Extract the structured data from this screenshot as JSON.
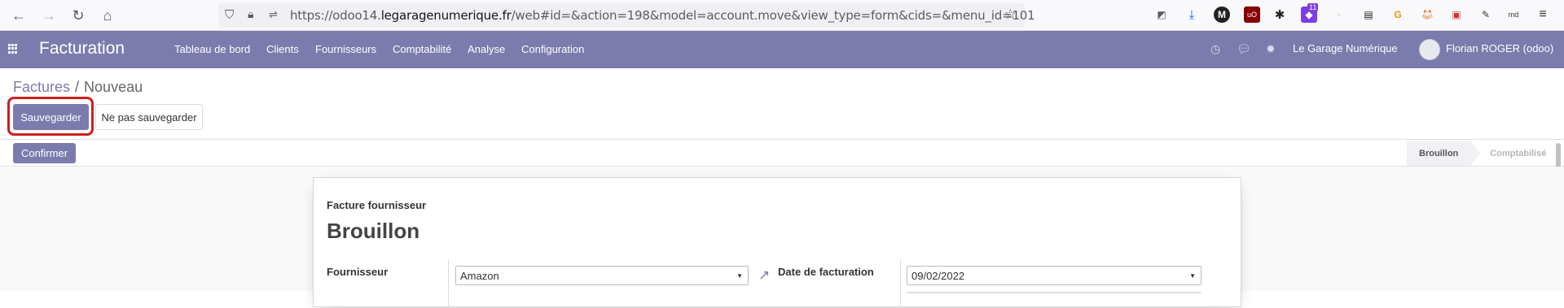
{
  "browser": {
    "url_prefix": "https://odoo14.",
    "url_domain": "legaragenumerique.fr",
    "url_path": "/web#id=&action=198&model=account.move&view_type=form&cids=&menu_id=101",
    "extension_badge": "11",
    "icons": [
      "back-arrow",
      "forward-arrow",
      "reload",
      "home",
      "shield",
      "lock",
      "permissions",
      "star",
      "pocket",
      "download",
      "m-extension",
      "ublock",
      "extension",
      "notification-extension",
      "tab-extension",
      "notes",
      "g-extension",
      "metamask",
      "media",
      "dropper",
      "md-extension",
      "hamburger-menu"
    ]
  },
  "navbar": {
    "brand": "Facturation",
    "menu": [
      "Tableau de bord",
      "Clients",
      "Fournisseurs",
      "Comptabilité",
      "Analyse",
      "Configuration"
    ],
    "company": "Le Garage Numérique",
    "user": "Florian ROGER (odoo)"
  },
  "breadcrumb": {
    "parent": "Factures",
    "separator": "/",
    "current": "Nouveau"
  },
  "buttons": {
    "save": "Sauvegarder",
    "discard": "Ne pas sauvegarder",
    "confirm": "Confirmer"
  },
  "status": {
    "stages": [
      "Brouillon",
      "Comptabilisé"
    ],
    "active": "Brouillon"
  },
  "sheet": {
    "subtitle": "Facture fournisseur",
    "title": "Brouillon",
    "fields": {
      "vendor_label": "Fournisseur",
      "vendor_value": "Amazon",
      "date_label": "Date de facturation",
      "date_value": "09/02/2022"
    }
  },
  "colors": {
    "accent": "#7c7bad",
    "highlight": "#cc1f1f"
  }
}
